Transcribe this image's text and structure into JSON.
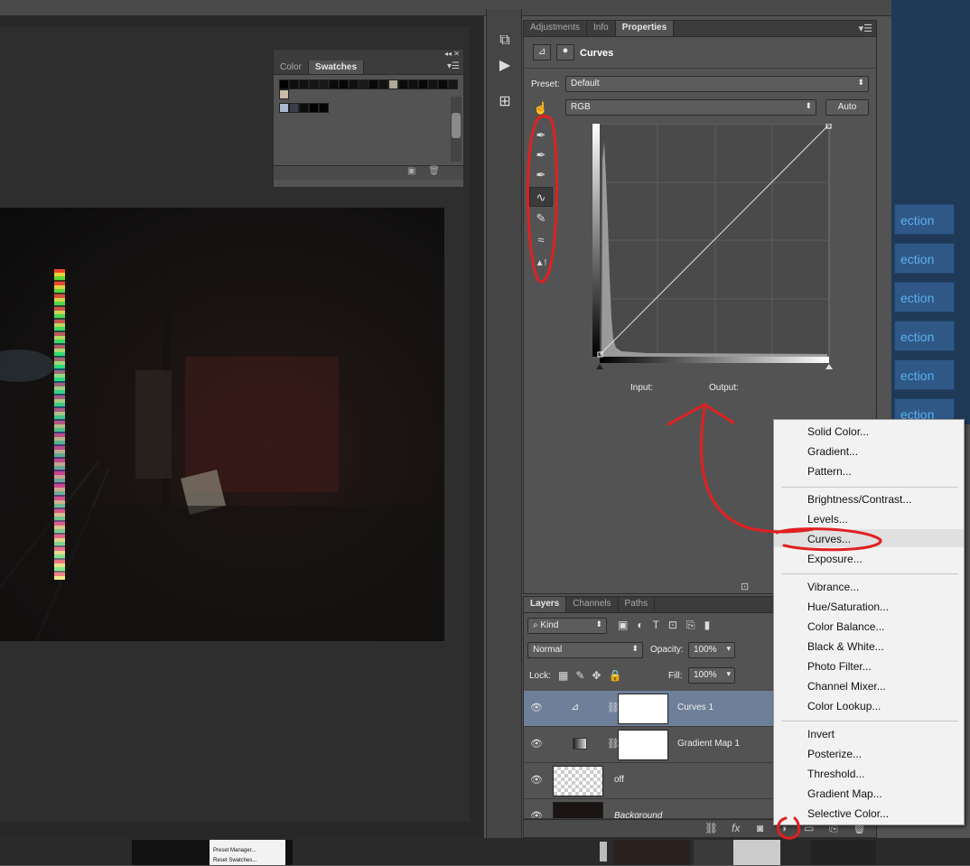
{
  "swatches_panel": {
    "tabs": [
      "Color",
      "Swatches"
    ]
  },
  "properties_panel": {
    "tabs": [
      "Adjustments",
      "Info",
      "Properties"
    ],
    "title": "Curves",
    "preset_label": "Preset:",
    "preset_value": "Default",
    "channel_value": "RGB",
    "auto_label": "Auto",
    "input_label": "Input:",
    "output_label": "Output:"
  },
  "layers_panel": {
    "tabs": [
      "Layers",
      "Channels",
      "Paths"
    ],
    "kind_value": "Kind",
    "blend_mode": "Normal",
    "opacity_label": "Opacity:",
    "opacity_value": "100%",
    "lock_label": "Lock:",
    "fill_label": "Fill:",
    "fill_value": "100%",
    "layers": [
      {
        "name": "Curves 1"
      },
      {
        "name": "Gradient Map 1"
      },
      {
        "name": "off"
      },
      {
        "name": "Background"
      }
    ],
    "footer_fx": "fx"
  },
  "adjustment_menu": {
    "items": [
      "Solid Color...",
      "Gradient...",
      "Pattern...",
      "Brightness/Contrast...",
      "Levels...",
      "Curves...",
      "Exposure...",
      "Vibrance...",
      "Hue/Saturation...",
      "Color Balance...",
      "Black & White...",
      "Photo Filter...",
      "Channel Mixer...",
      "Color Lookup...",
      "Invert",
      "Posterize...",
      "Threshold...",
      "Gradient Map...",
      "Selective Color..."
    ]
  },
  "right_buttons": [
    "ection",
    "ection",
    "ection",
    "ection",
    "ection",
    "ection"
  ],
  "taskbar": {
    "popup_items": [
      "Preset Manager...",
      "Reset Swatches..."
    ]
  },
  "colors": {
    "selection_blue": "#6e7f99",
    "annotation_red": "#e02020"
  }
}
